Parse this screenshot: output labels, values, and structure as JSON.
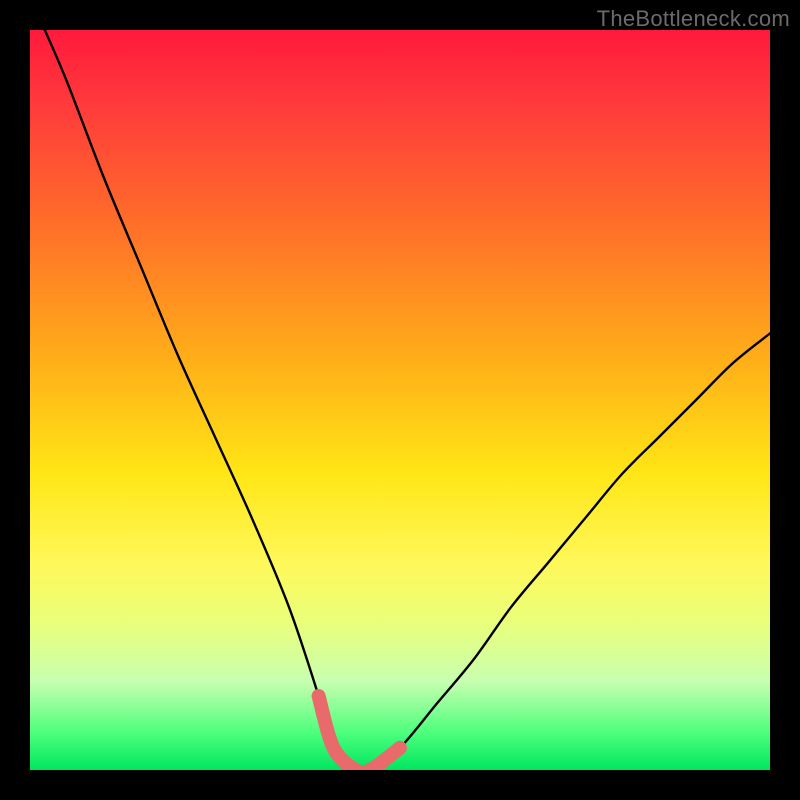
{
  "watermark": "TheBottleneck.com",
  "gradient": {
    "top": "#ff1a3c",
    "mid": "#ffe616",
    "bottom": "#00e660"
  },
  "chart_data": {
    "type": "line",
    "title": "",
    "xlabel": "",
    "ylabel": "",
    "xlim": [
      0,
      100
    ],
    "ylim": [
      0,
      100
    ],
    "series": [
      {
        "name": "bottleneck-curve",
        "x": [
          2,
          5,
          10,
          15,
          20,
          25,
          30,
          35,
          39,
          41,
          44,
          46,
          50,
          55,
          60,
          65,
          70,
          75,
          80,
          85,
          90,
          95,
          100
        ],
        "values": [
          100,
          93,
          80,
          68,
          56,
          45,
          34,
          22,
          10,
          3,
          0,
          0,
          3,
          9,
          15,
          22,
          28,
          34,
          40,
          45,
          50,
          55,
          59
        ]
      }
    ],
    "highlight": {
      "name": "flat-bottom",
      "color": "#e86a6a",
      "x": [
        39,
        41,
        44,
        46,
        50
      ],
      "values": [
        10,
        3,
        0,
        0,
        3
      ]
    }
  }
}
